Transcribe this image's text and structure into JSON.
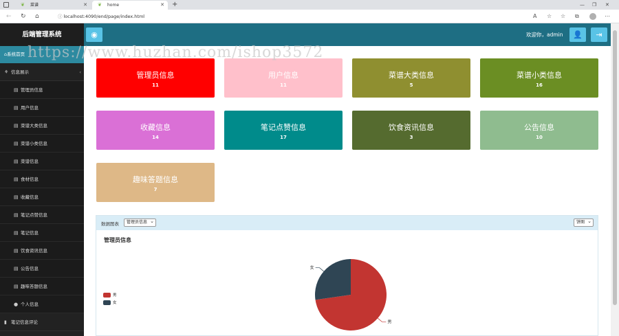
{
  "browser": {
    "tabs": [
      {
        "label": "菜谱",
        "active": false
      },
      {
        "label": "home",
        "active": true
      }
    ],
    "url": "localhost:4090/end/page/index.html"
  },
  "header": {
    "brand": "后端管理系统",
    "welcome": "欢迎你，admin"
  },
  "watermark": "https://www.huzhan.com/ishop3572",
  "sidebar": {
    "top": "系统首页",
    "group_info": "信息展示",
    "items": [
      "管理员信息",
      "用户信息",
      "菜谱大类信息",
      "菜谱小类信息",
      "菜谱信息",
      "食材信息",
      "收藏信息",
      "笔记点赞信息",
      "笔记信息",
      "饮食资讯信息",
      "公告信息",
      "趣味答题信息",
      "个人信息"
    ],
    "group_comment": "笔记信息评论"
  },
  "cards": [
    {
      "title": "管理员信息",
      "count": "11",
      "color": "#ff0000"
    },
    {
      "title": "用户信息",
      "count": "11",
      "color": "#ffc0cb"
    },
    {
      "title": "菜谱大类信息",
      "count": "5",
      "color": "#8f8f30"
    },
    {
      "title": "菜谱小类信息",
      "count": "16",
      "color": "#6b8e23"
    },
    {
      "title": "收藏信息",
      "count": "14",
      "color": "#da70d6"
    },
    {
      "title": "笔记点赞信息",
      "count": "17",
      "color": "#008b8b"
    },
    {
      "title": "饮食资讯信息",
      "count": "3",
      "color": "#556b2f"
    },
    {
      "title": "公告信息",
      "count": "10",
      "color": "#8fbc8f"
    },
    {
      "title": "趣味答题信息",
      "count": "7",
      "color": "#deb887"
    }
  ],
  "chart_panel": {
    "label": "数据图表",
    "selected_table": "管理员信息",
    "chart_type": "饼图"
  },
  "chart_data": {
    "type": "pie",
    "title": "管理员信息",
    "categories": [
      "男",
      "女"
    ],
    "values": [
      8,
      3
    ],
    "colors": [
      "#c23531",
      "#2f4554"
    ],
    "legend": "left"
  }
}
